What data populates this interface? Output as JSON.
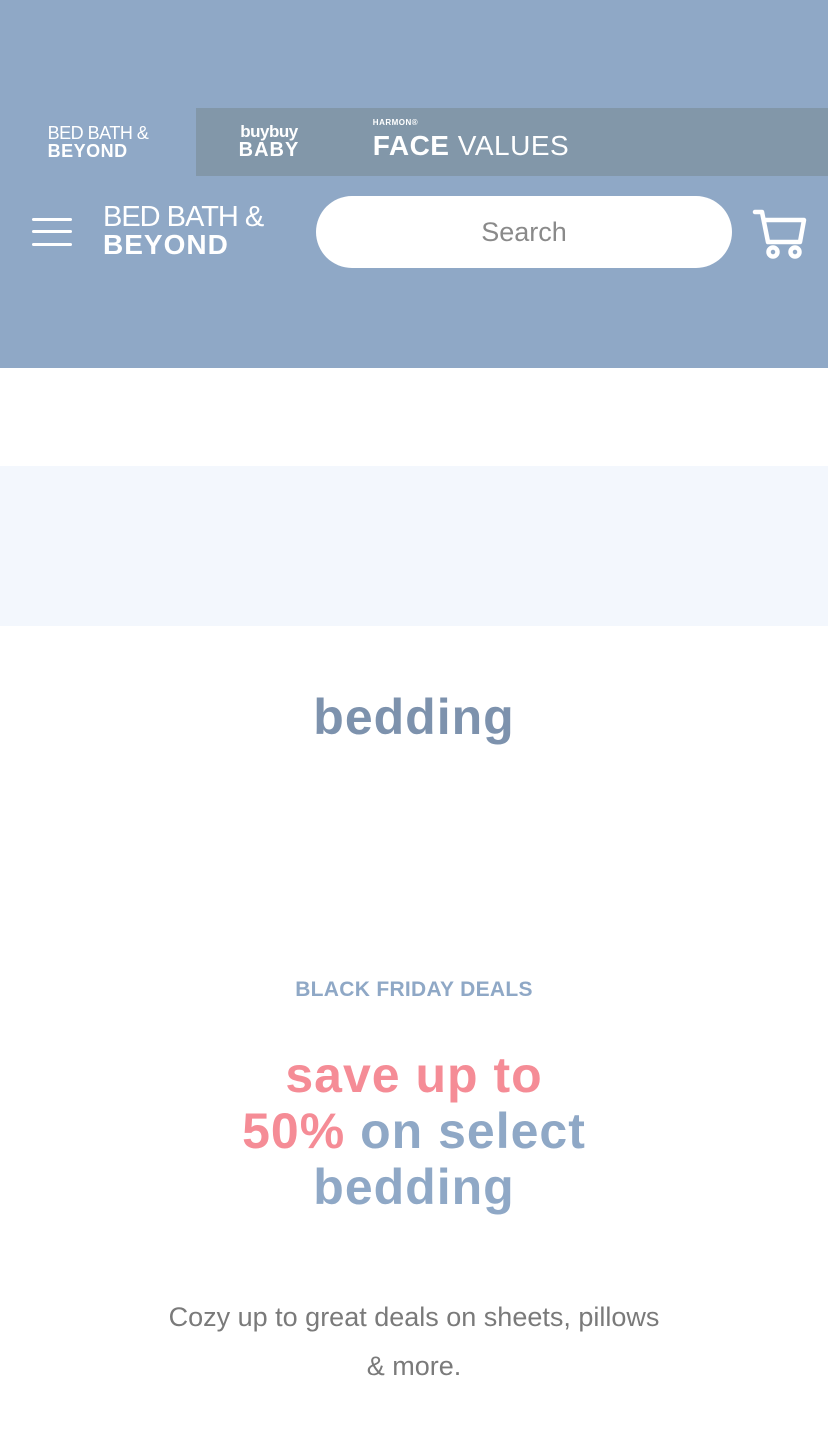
{
  "header": {
    "background_color": "#8fa8c6",
    "brands": [
      {
        "name": "Bed Bath & Beyond",
        "line1": "BED BATH &",
        "line2": "BEYOND",
        "active": true
      },
      {
        "name": "buybuy BABY",
        "line1": "buybuy",
        "line2": "BABY",
        "active": false
      },
      {
        "name": "Harmon Face Values",
        "line0": "HARMON®",
        "line1": "FACE",
        "line2": "VALUES",
        "active": false
      }
    ],
    "main_logo": {
      "line1": "BED BATH &",
      "line2": "BEYOND"
    },
    "search": {
      "placeholder": "Search"
    },
    "icons": {
      "menu": "hamburger-menu-icon",
      "cart": "shopping-cart-icon"
    }
  },
  "main": {
    "page_title": "bedding",
    "promo": {
      "eyebrow": "BLACK FRIDAY DEALS",
      "headline_part1": "save up to",
      "headline_part2": "50%",
      "headline_part3": "on select",
      "headline_part4": "bedding",
      "body": "Cozy up to great deals on sheets, pillows & more."
    }
  },
  "colors": {
    "brand_blue": "#8fa8c6",
    "title_blue": "#7d92ad",
    "promo_pink": "#f58c96",
    "band_light": "#f3f7fd"
  }
}
